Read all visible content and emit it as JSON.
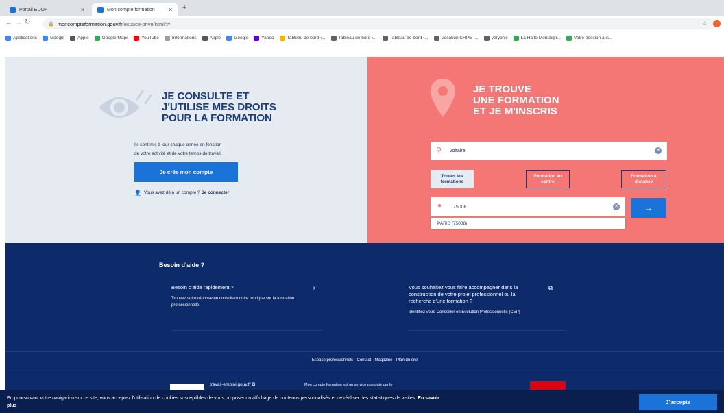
{
  "browser": {
    "tabs": [
      {
        "label": "Portail EDOF"
      },
      {
        "label": "Mon compte formation"
      }
    ],
    "url_host": "moncompteformation.gouv.fr",
    "url_path": "/espace-prive/html/#/",
    "bookmarks": [
      {
        "label": "Applications",
        "color": "#4285f4"
      },
      {
        "label": "Google",
        "color": "#4285f4"
      },
      {
        "label": "Apple",
        "color": "#555555"
      },
      {
        "label": "Google Maps",
        "color": "#34a853"
      },
      {
        "label": "YouTube",
        "color": "#ff0000"
      },
      {
        "label": "Informations",
        "color": "#9aa0a6"
      },
      {
        "label": "Apple",
        "color": "#555555"
      },
      {
        "label": "Google",
        "color": "#4285f4"
      },
      {
        "label": "Yahoo",
        "color": "#6001d2"
      },
      {
        "label": "Tableau de bord ‹...",
        "color": "#f4b400"
      },
      {
        "label": "Tableau de bord ‹...",
        "color": "#5f6368"
      },
      {
        "label": "Tableau de bord ‹...",
        "color": "#5f6368"
      },
      {
        "label": "Vocation CRPE -...",
        "color": "#5f6368"
      },
      {
        "label": "verychic",
        "color": "#5f6368"
      },
      {
        "label": "La Halte Montaign...",
        "color": "#34a853"
      },
      {
        "label": "Votre position à is...",
        "color": "#34a853"
      }
    ]
  },
  "left_panel": {
    "title_lines": [
      "JE CONSULTE ET",
      "J'UTILISE MES DROITS",
      "POUR LA FORMATION"
    ],
    "desc_line1": "Ils sont mis à jour chaque année en fonction",
    "desc_line2": "de votre activité et de votre temps de travail.",
    "create_button": "Je crée mon compte",
    "login_prompt": "Vous avez déjà un compte ?",
    "login_link": "Se connecter"
  },
  "right_panel": {
    "title_lines": [
      "JE TROUVE",
      "UNE FORMATION",
      "ET JE M'INSCRIS"
    ],
    "search_value": "voltaire",
    "filters": [
      {
        "label": "Toutes les formations",
        "selected": true
      },
      {
        "label": "Formation en centre",
        "selected": false
      },
      {
        "label": "Formation à distance",
        "selected": false
      }
    ],
    "location_value": "75008",
    "suggestion": "PARIS (75008)"
  },
  "help": {
    "title": "Besoin d'aide ?",
    "card1_title": "Besoin d'aide rapidement ?",
    "card1_text": "Trouvez votre réponse en consultant notre rubrique sur la formation professionnelle",
    "card2_title": "Vous souhaitez vous faire accompagner dans la construction de votre projet professionnel ou la recherche d'une formation ?",
    "card2_text": "Identifiez votre Conseiller en Evolution Professionnelle (CEP)",
    "footer_links": "Espace professionnels - Contact - Magazine - Plan du site",
    "partner_link": "travail-emploi.gouv.fr",
    "mandate_text": "Mon compte formation est un service mandaté par le"
  },
  "cookie": {
    "text": "En poursuivant votre navigation sur ce site, vous acceptez l'utilisation de cookies susceptibles de vous proposer un affichage de contenus personnalisés et de réaliser des statistiques de visites.",
    "more_link": "En savoir plus",
    "accept_button": "J'accepte"
  },
  "colors": {
    "navy": "#0d2b6b",
    "coral": "#f47775",
    "blue_button": "#1a73d9",
    "light_panel": "#e6ebf2"
  }
}
